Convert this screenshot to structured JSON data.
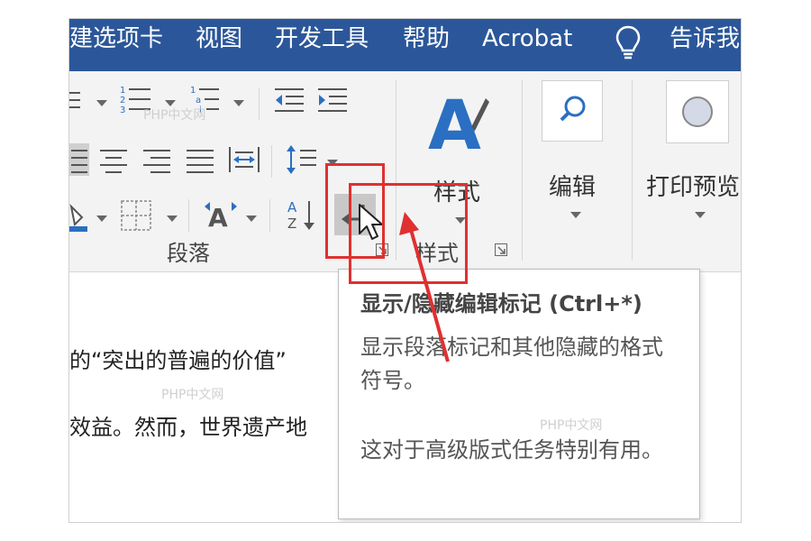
{
  "menubar": {
    "tabs": [
      "建选项卡",
      "视图",
      "开发工具",
      "帮助",
      "Acrobat"
    ],
    "tell_me": "告诉我"
  },
  "ribbon": {
    "paragraph_group_label": "段落",
    "styles_group_label": "样式",
    "styles_button_label": "样式",
    "edit_button_label": "编辑",
    "print_preview_button_label": "打印预览"
  },
  "tooltip": {
    "title": "显示/隐藏编辑标记 (Ctrl+*)",
    "description": "显示段落标记和其他隐藏的格式符号。",
    "note": "这对于高级版式任务特别有用。"
  },
  "document": {
    "line1": "的“突出的普遍的价值”",
    "line2": "效益。然而，世界遗产地"
  },
  "watermark": "PHP中文网",
  "colors": {
    "menubar_bg": "#2b579a",
    "accent_blue": "#2b6fc2",
    "highlight_red": "#e03030"
  }
}
